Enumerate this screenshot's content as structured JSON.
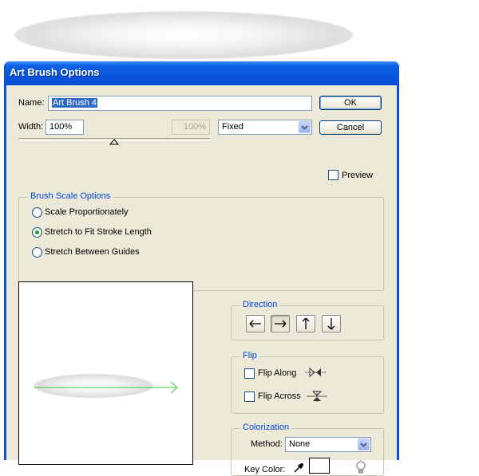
{
  "window": {
    "title": "Art Brush Options"
  },
  "name_field": {
    "label": "Name:",
    "value": "Art Brush 4"
  },
  "width_field": {
    "label": "Width:",
    "value": "100%",
    "secondary_value": "100%",
    "mode": "Fixed"
  },
  "buttons": {
    "ok": "OK",
    "cancel": "Cancel"
  },
  "preview": {
    "label": "Preview",
    "checked": false
  },
  "brush_scale": {
    "legend": "Brush Scale Options",
    "options": [
      {
        "label": "Scale Proportionately",
        "selected": false
      },
      {
        "label": "Stretch to Fit Stroke Length",
        "selected": true
      },
      {
        "label": "Stretch Between Guides",
        "selected": false
      }
    ]
  },
  "direction": {
    "legend": "Direction",
    "buttons": [
      {
        "icon": "arrow-left-icon",
        "glyph": "←",
        "active": false
      },
      {
        "icon": "arrow-right-icon",
        "glyph": "→",
        "active": true
      },
      {
        "icon": "arrow-up-icon",
        "glyph": "↑",
        "active": false
      },
      {
        "icon": "arrow-down-icon",
        "glyph": "↓",
        "active": false
      }
    ]
  },
  "flip": {
    "legend": "Flip",
    "along": {
      "label": "Flip Along",
      "checked": false
    },
    "across": {
      "label": "Flip Across",
      "checked": false
    }
  },
  "colorization": {
    "legend": "Colorization",
    "method_label": "Method:",
    "method_value": "None",
    "key_color_label": "Key Color:"
  },
  "colors": {
    "title_bar": "#0a55dc",
    "dialog_bg": "#ece9d8",
    "legend_text": "#0046d5",
    "preview_arrow": "#3ccc3c"
  }
}
